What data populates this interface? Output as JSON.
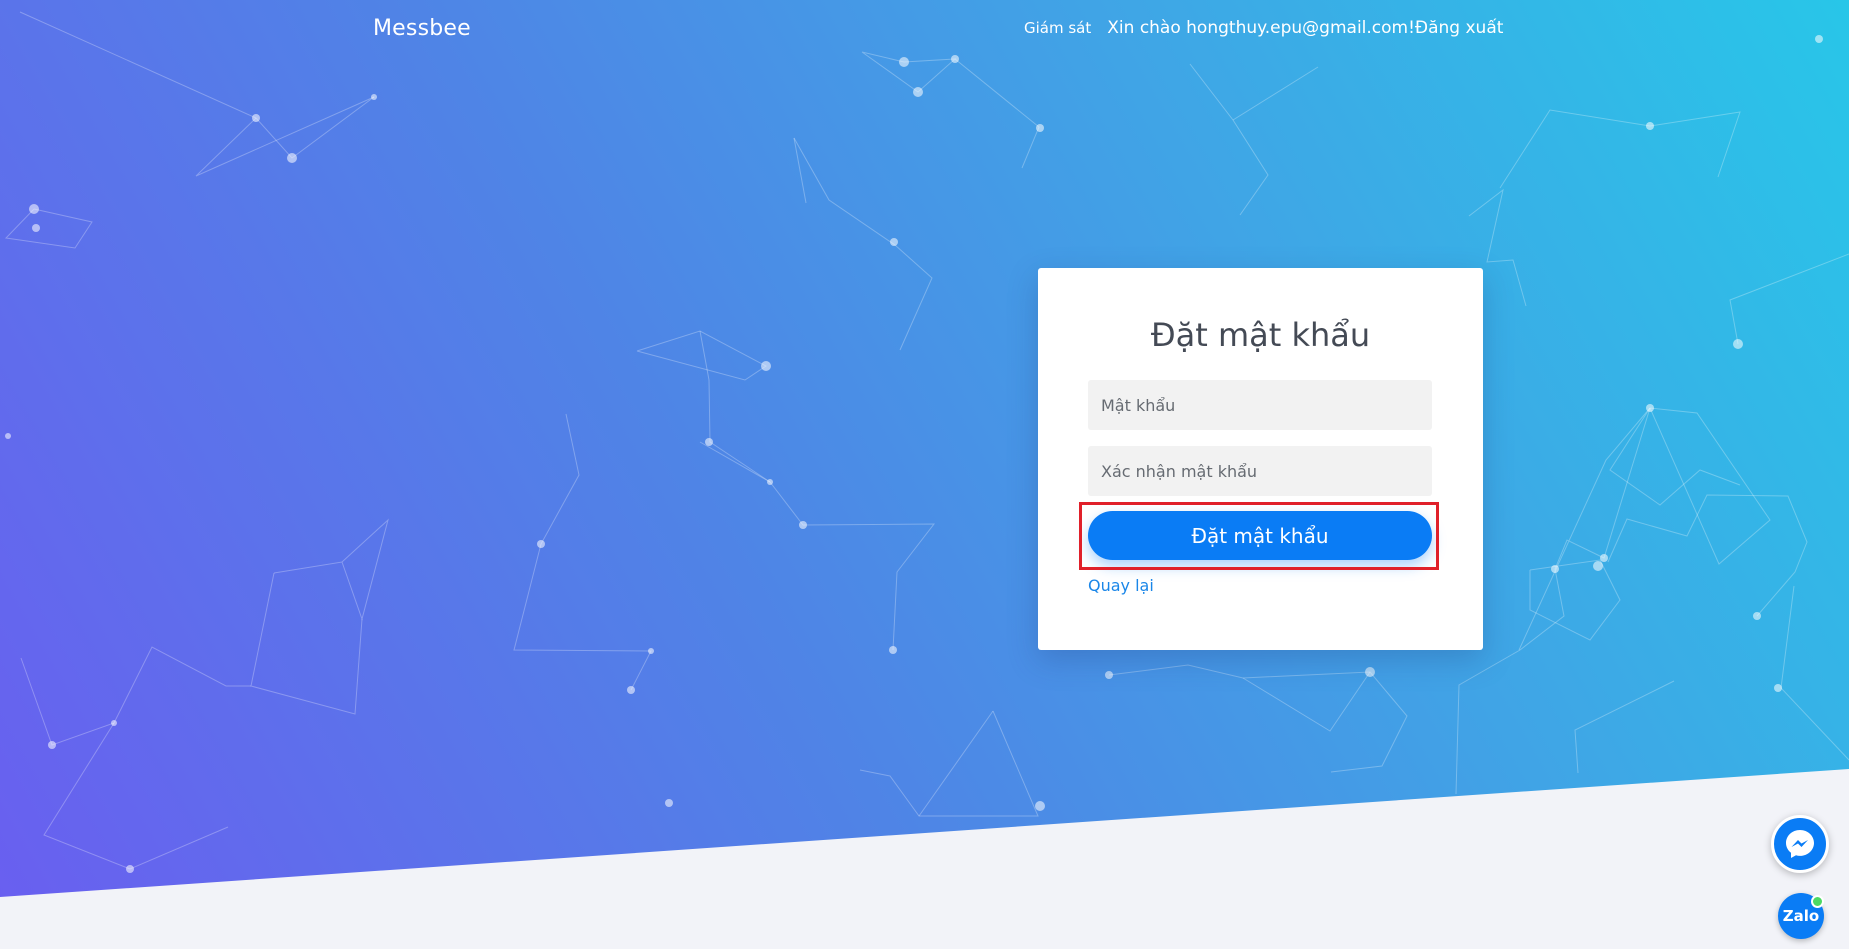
{
  "header": {
    "brand": "Messbee",
    "monitor_label": "Giám sát",
    "greeting": "Xin chào hongthuy.epu@gmail.com!",
    "logout_label": "Đăng xuất"
  },
  "form": {
    "title": "Đặt mật khẩu",
    "password_placeholder": "Mật khẩu",
    "confirm_placeholder": "Xác nhận mật khẩu",
    "submit_label": "Đặt mật khẩu",
    "back_label": "Quay lại"
  },
  "floating": {
    "messenger_icon": "messenger-icon",
    "zalo_label": "Zalo"
  },
  "colors": {
    "gradient_start": "#6a5ef0",
    "gradient_end": "#28c6e8",
    "primary_button": "#0a7cf5",
    "link": "#1a86e8",
    "highlight_border": "#e0202a",
    "footer_bg": "#f2f3f8"
  }
}
